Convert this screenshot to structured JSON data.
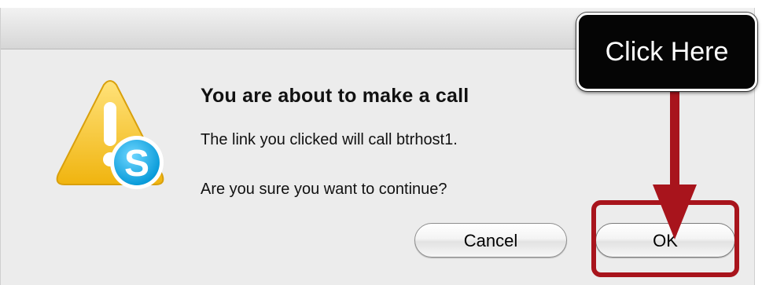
{
  "dialog": {
    "title": "You are about to make a call",
    "message_line1": "The link you clicked will call btrhost1.",
    "message_line2": "Are you sure you want to continue?",
    "icon": "warning-skype-icon",
    "buttons": {
      "cancel_label": "Cancel",
      "ok_label": "OK"
    }
  },
  "annotation": {
    "callout_text": "Click Here",
    "arrow_icon": "arrow-down-icon",
    "highlight_color": "#a8141c"
  },
  "colors": {
    "warning_yellow": "#f5c71a",
    "skype_blue": "#00aff0"
  }
}
